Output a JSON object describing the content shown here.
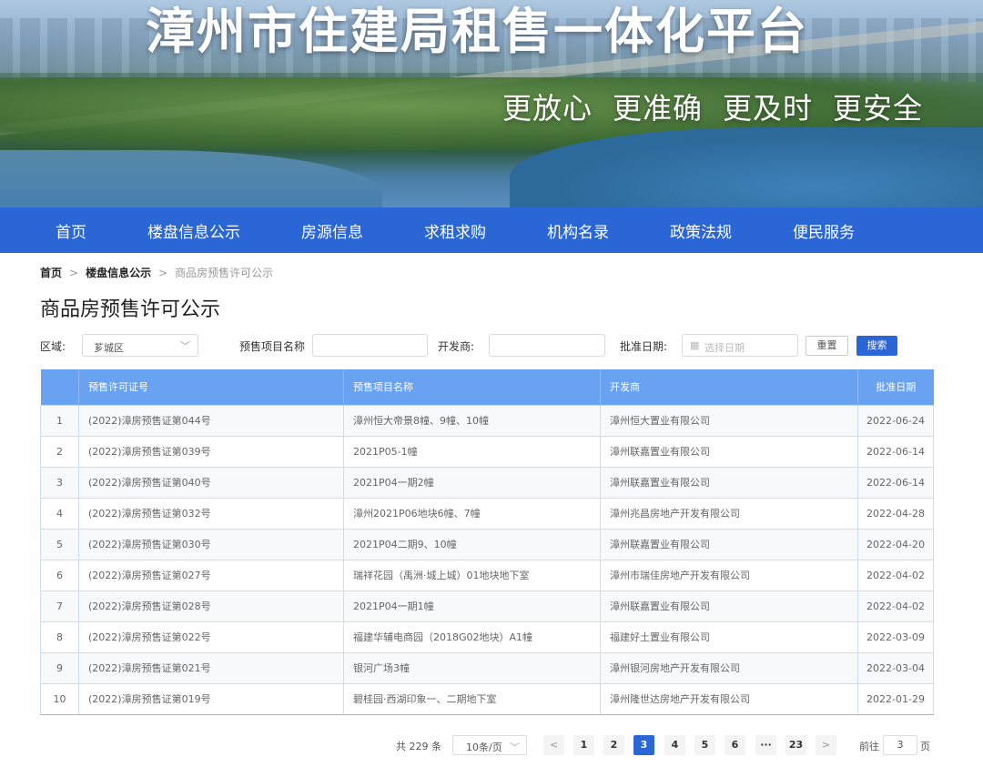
{
  "banner": {
    "title": "漳州市住建局租售一体化平台",
    "slogans": [
      "更放心",
      "更准确",
      "更及时",
      "更安全"
    ]
  },
  "nav": [
    "首页",
    "楼盘信息公示",
    "房源信息",
    "求租求购",
    "机构名录",
    "政策法规",
    "便民服务"
  ],
  "breadcrumb": {
    "home": "首页",
    "sep": ">",
    "section": "楼盘信息公示",
    "current": "商品房预售许可公示"
  },
  "page_title": "商品房预售许可公示",
  "filters": {
    "region_label": "区域:",
    "region_value": "芗城区",
    "project_label": "预售项目名称",
    "project_value": "",
    "developer_label": "开发商:",
    "developer_value": "",
    "date_label": "批准日期:",
    "date_placeholder": "选择日期",
    "reset_label": "重置",
    "search_label": "搜索"
  },
  "table": {
    "headers": [
      "",
      "预售许可证号",
      "预售项目名称",
      "开发商",
      "批准日期"
    ],
    "rows": [
      [
        "1",
        "(2022)漳房预售证第044号",
        "漳州恒大帝景8幢、9幢、10幢",
        "漳州恒大置业有限公司",
        "2022-06-24"
      ],
      [
        "2",
        "(2022)漳房预售证第039号",
        "2021P05-1幢",
        "漳州联嘉置业有限公司",
        "2022-06-14"
      ],
      [
        "3",
        "(2022)漳房预售证第040号",
        "2021P04一期2幢",
        "漳州联嘉置业有限公司",
        "2022-06-14"
      ],
      [
        "4",
        "(2022)漳房预售证第032号",
        "漳州2021P06地块6幢、7幢",
        "漳州兆昌房地产开发有限公司",
        "2022-04-28"
      ],
      [
        "5",
        "(2022)漳房预售证第030号",
        "2021P04二期9、10幢",
        "漳州联嘉置业有限公司",
        "2022-04-20"
      ],
      [
        "6",
        "(2022)漳房预售证第027号",
        "瑞祥花园（禹洲·城上城）01地块地下室",
        "漳州市瑞佳房地产开发有限公司",
        "2022-04-02"
      ],
      [
        "7",
        "(2022)漳房预售证第028号",
        "2021P04一期1幢",
        "漳州联嘉置业有限公司",
        "2022-04-02"
      ],
      [
        "8",
        "(2022)漳房预售证第022号",
        "福建华辅电商园（2018G02地块）A1幢",
        "福建好土置业有限公司",
        "2022-03-09"
      ],
      [
        "9",
        "(2022)漳房预售证第021号",
        "银河广场3幢",
        "漳州银河房地产开发有限公司",
        "2022-03-04"
      ],
      [
        "10",
        "(2022)漳房预售证第019号",
        "碧桂园·西湖印象一、二期地下室",
        "漳州隆世达房地产开发有限公司",
        "2022-01-29"
      ]
    ]
  },
  "pager": {
    "total": "共 229 条",
    "page_size": "10条/页",
    "prev": "<",
    "next": ">",
    "pages": [
      "1",
      "2",
      "3",
      "4",
      "5",
      "6",
      "···",
      "23"
    ],
    "current_page": "3",
    "goto_prefix": "前往",
    "goto_value": "3",
    "goto_suffix": "页"
  },
  "colors": {
    "nav_bg": "#2a66d6",
    "table_header_bg": "#6aa2f2",
    "primary": "#2a66d6"
  }
}
